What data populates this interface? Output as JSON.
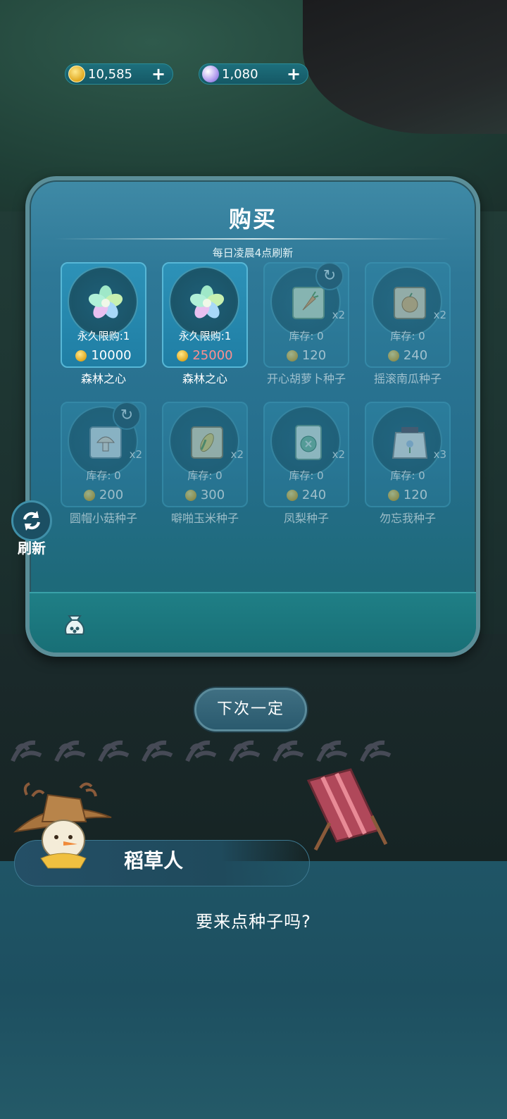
{
  "currency": {
    "gold": {
      "value": "10,585",
      "icon": "gold-coin-icon",
      "add": "+"
    },
    "moon": {
      "value": "1,080",
      "icon": "moon-gem-icon",
      "add": "+"
    }
  },
  "shop": {
    "title": "购买",
    "subtitle": "每日凌晨4点刷新",
    "items": [
      {
        "name": "森林之心",
        "stock": "永久限购:1",
        "price": "10000",
        "mult": "",
        "icon": "forest-heart-icon",
        "state": "active",
        "price_red": false
      },
      {
        "name": "森林之心",
        "stock": "永久限购:1",
        "price": "25000",
        "mult": "",
        "icon": "forest-heart-icon",
        "state": "active",
        "price_red": true
      },
      {
        "name": "开心胡萝卜种子",
        "stock": "库存: 0",
        "price": "120",
        "mult": "x2",
        "icon": "carrot-seed-icon",
        "state": "sold-out",
        "price_red": false
      },
      {
        "name": "摇滚南瓜种子",
        "stock": "库存: 0",
        "price": "240",
        "mult": "x2",
        "icon": "pumpkin-seed-icon",
        "state": "sold-out",
        "price_red": false
      },
      {
        "name": "圆帽小菇种子",
        "stock": "库存: 0",
        "price": "200",
        "mult": "x2",
        "icon": "mushroom-seed-icon",
        "state": "sold-out",
        "price_red": false
      },
      {
        "name": "噼啪玉米种子",
        "stock": "库存: 0",
        "price": "300",
        "mult": "x2",
        "icon": "corn-seed-icon",
        "state": "sold-out",
        "price_red": false
      },
      {
        "name": "凤梨种子",
        "stock": "库存: 0",
        "price": "240",
        "mult": "x2",
        "icon": "pineapple-seed-icon",
        "state": "sold-out",
        "price_red": false
      },
      {
        "name": "勿忘我种子",
        "stock": "库存: 0",
        "price": "120",
        "mult": "x3",
        "icon": "forget-me-not-seed-icon",
        "state": "sold-out",
        "price_red": false
      }
    ],
    "bottom_icon": "seed-bag-icon"
  },
  "refresh": {
    "label": "刷新",
    "icon": "refresh-icon"
  },
  "next_button": {
    "label": "下次一定"
  },
  "dialog": {
    "speaker": "稻草人",
    "text": "要来点种子吗?"
  },
  "colors": {
    "panel": "#2a7896",
    "dialog": "#1d4f60",
    "price_red": "#ff8f8f",
    "gold": "#e0a820"
  }
}
